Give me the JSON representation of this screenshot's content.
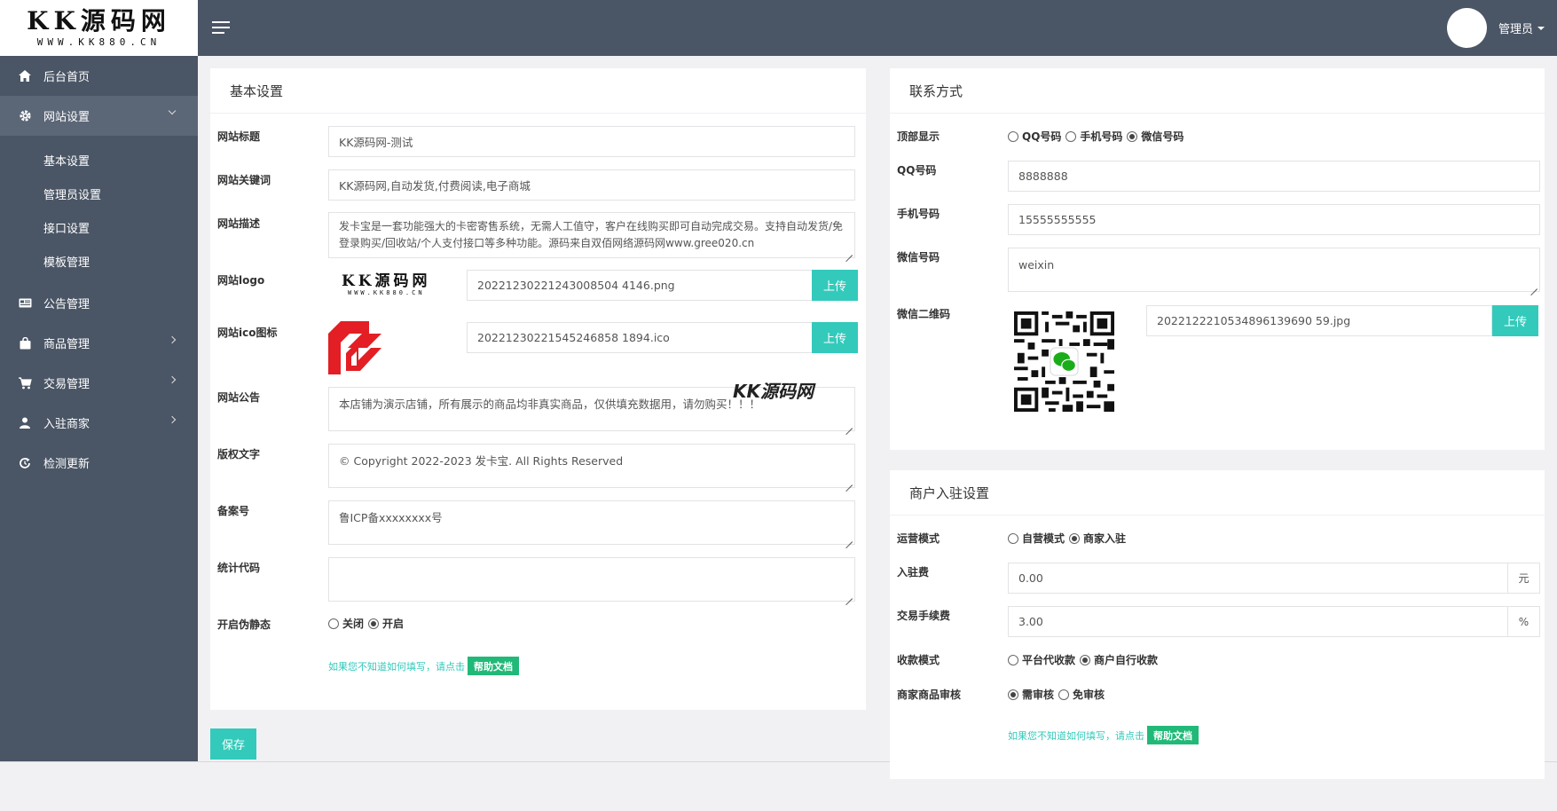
{
  "brand": {
    "logo_main": "KK源码网",
    "logo_sub": "WWW.KK880.CN"
  },
  "header": {
    "user_label": "管理员"
  },
  "sidebar": {
    "items": [
      {
        "label": "后台首页",
        "icon": "home-icon"
      },
      {
        "label": "网站设置",
        "icon": "gear-icon"
      },
      {
        "label": "公告管理",
        "icon": "news-icon"
      },
      {
        "label": "商品管理",
        "icon": "bag-icon"
      },
      {
        "label": "交易管理",
        "icon": "cart-icon"
      },
      {
        "label": "入驻商家",
        "icon": "user-icon"
      },
      {
        "label": "检测更新",
        "icon": "refresh-icon"
      }
    ],
    "sub_items": [
      "基本设置",
      "管理员设置",
      "接口设置",
      "模板管理"
    ]
  },
  "basic": {
    "title": "基本设置",
    "site_title_label": "网站标题",
    "site_title_value": "KK源码网-测试",
    "keywords_label": "网站关键词",
    "keywords_value": "KK源码网,自动发货,付费阅读,电子商城",
    "desc_label": "网站描述",
    "desc_value": "发卡宝是一套功能强大的卡密寄售系统，无需人工值守，客户在线购买即可自动完成交易。支持自动发货/免登录购买/回收站/个人支付接口等多种功能。源码来自双佰网络源码网www.gree020.cn",
    "logo_label": "网站logo",
    "logo_file": "20221230221243008504 4146.png",
    "ico_label": "网站ico图标",
    "ico_file": "20221230221545246858 1894.ico",
    "upload_label": "上传",
    "notice_label": "网站公告",
    "notice_value": "本店铺为演示店铺，所有展示的商品均非真实商品，仅供填充数据用，请勿购买！！！",
    "copyright_label": "版权文字",
    "copyright_value": "© Copyright 2022-2023 发卡宝. All Rights Reserved",
    "icp_label": "备案号",
    "icp_value": "鲁ICP备xxxxxxxx号",
    "stats_label": "统计代码",
    "stats_value": "",
    "pseudo_label": "开启伪静态",
    "pseudo_off": "关闭",
    "pseudo_on": "开启",
    "help_text": "如果您不知道如何填写，请点击",
    "help_button": "帮助文档",
    "save": "保存"
  },
  "contact": {
    "title": "联系方式",
    "top_label": "顶部显示",
    "opt_qq": "QQ号码",
    "opt_phone": "手机号码",
    "opt_wechat": "微信号码",
    "qq_label": "QQ号码",
    "qq_value": "8888888",
    "phone_label": "手机号码",
    "phone_value": "15555555555",
    "wechat_label": "微信号码",
    "wechat_value": "weixin",
    "qr_label": "微信二维码",
    "qr_file": "2022122210534896139690 59.jpg",
    "upload_label": "上传"
  },
  "merchant": {
    "title": "商户入驻设置",
    "mode_label": "运营模式",
    "mode_self": "自营模式",
    "mode_merchant": "商家入驻",
    "fee_label": "入驻费",
    "fee_value": "0.00",
    "fee_unit": "元",
    "tx_label": "交易手续费",
    "tx_value": "3.00",
    "tx_unit": "%",
    "collect_label": "收款模式",
    "collect_platform": "平台代收款",
    "collect_self": "商户自行收款",
    "review_label": "商家商品审核",
    "review_need": "需审核",
    "review_free": "免审核",
    "help_text": "如果您不知道如何填写，请点击",
    "help_button": "帮助文档"
  },
  "watermark": "KK源码网"
}
